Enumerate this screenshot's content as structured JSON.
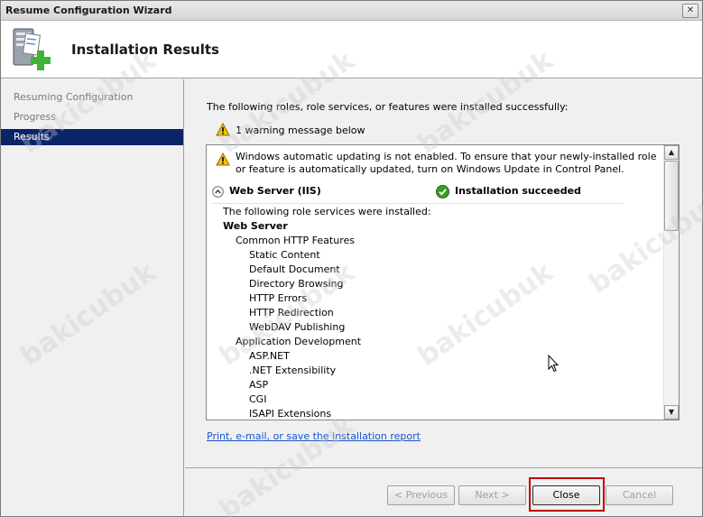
{
  "window": {
    "title": "Resume Configuration Wizard",
    "close_glyph": "✕"
  },
  "header": {
    "title": "Installation Results"
  },
  "nav": {
    "items": [
      {
        "label": "Resuming Configuration",
        "active": false
      },
      {
        "label": "Progress",
        "active": false
      },
      {
        "label": "Results",
        "active": true
      }
    ]
  },
  "main": {
    "intro": "The following roles, role services, or features were installed successfully:",
    "warning_summary": "1 warning message below",
    "panel": {
      "warning": "Windows automatic updating is not enabled. To ensure that your newly-installed role or feature is automatically updated, turn on Windows Update in Control Panel.",
      "role_name": "Web Server (IIS)",
      "status": "Installation succeeded",
      "services_intro": "The following role services were installed:",
      "services": [
        {
          "text": "Web Server",
          "level": 0,
          "bold": true
        },
        {
          "text": "Common HTTP Features",
          "level": 1
        },
        {
          "text": "Static Content",
          "level": 2
        },
        {
          "text": "Default Document",
          "level": 2
        },
        {
          "text": "Directory Browsing",
          "level": 2
        },
        {
          "text": "HTTP Errors",
          "level": 2
        },
        {
          "text": "HTTP Redirection",
          "level": 2
        },
        {
          "text": "WebDAV Publishing",
          "level": 2
        },
        {
          "text": "Application Development",
          "level": 1
        },
        {
          "text": "ASP.NET",
          "level": 2
        },
        {
          "text": ".NET Extensibility",
          "level": 2
        },
        {
          "text": "ASP",
          "level": 2
        },
        {
          "text": "CGI",
          "level": 2
        },
        {
          "text": "ISAPI Extensions",
          "level": 2
        }
      ]
    },
    "report_link": "Print, e-mail, or save the installation report"
  },
  "footer": {
    "previous": "< Previous",
    "next": "Next >",
    "close": "Close",
    "cancel": "Cancel"
  },
  "watermark": "bakicubuk",
  "colors": {
    "selection": "#0a246a",
    "link": "#1a55cc",
    "highlight_box": "#c00000",
    "success": "#3a9a2a",
    "warning": "#f2c200"
  }
}
